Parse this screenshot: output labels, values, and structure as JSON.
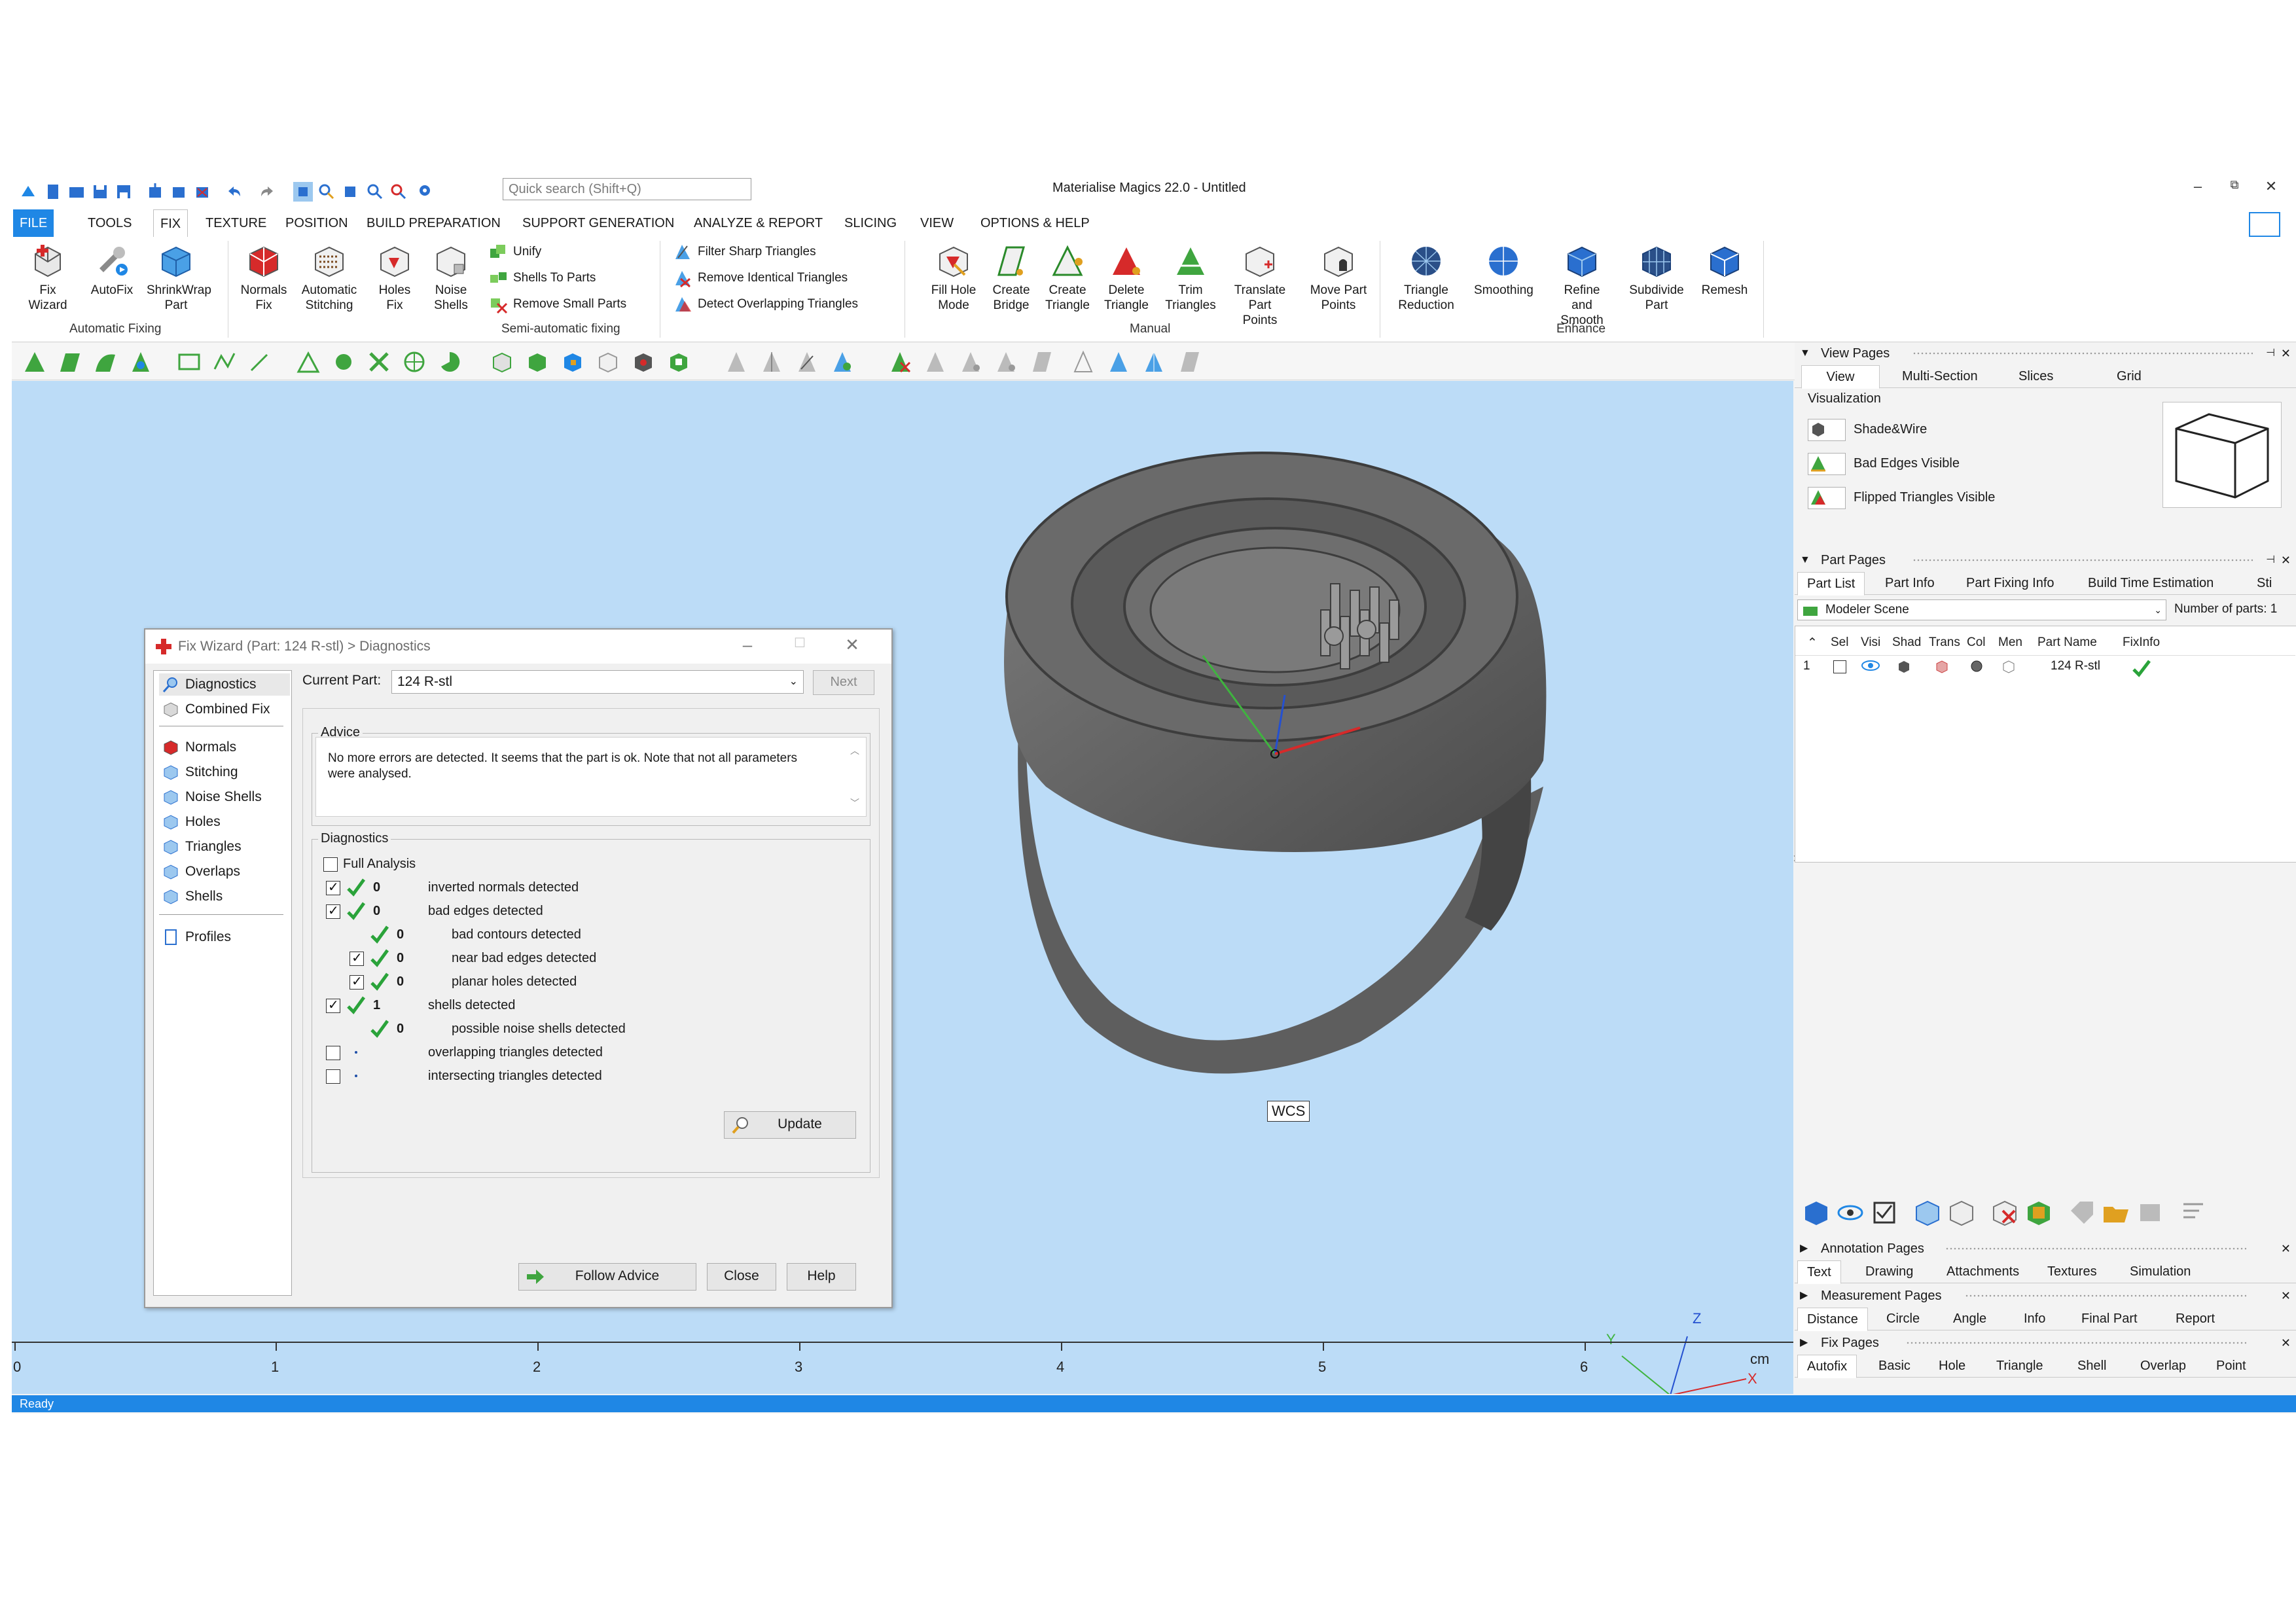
{
  "window": {
    "title": "Materialise Magics 22.0 - Untitled",
    "search_placeholder": "Quick search (Shift+Q)",
    "minimize": "–",
    "restore": "⧉",
    "close": "✕"
  },
  "menu": [
    "FILE",
    "TOOLS",
    "FIX",
    "TEXTURE",
    "POSITION",
    "BUILD PREPARATION",
    "SUPPORT GENERATION",
    "ANALYZE & REPORT",
    "SLICING",
    "VIEW",
    "OPTIONS & HELP"
  ],
  "ribbon": {
    "automatic_fixing": {
      "group": "Automatic Fixing",
      "buttons": [
        [
          "Fix",
          "Wizard"
        ],
        [
          "AutoFix",
          ""
        ],
        [
          "ShrinkWrap",
          "Part"
        ]
      ]
    },
    "semi_auto": {
      "group": "Semi-automatic fixing",
      "buttons": [
        [
          "Normals",
          "Fix"
        ],
        [
          "Automatic",
          "Stitching"
        ],
        [
          "Holes",
          "Fix"
        ],
        [
          "Noise",
          "Shells"
        ]
      ],
      "small": [
        "Unify",
        "Shells To Parts",
        "Remove Small Parts"
      ]
    },
    "triangles": {
      "small": [
        "Filter Sharp Triangles",
        "Remove Identical Triangles",
        "Detect Overlapping Triangles"
      ]
    },
    "manual": {
      "group": "Manual",
      "buttons": [
        [
          "Fill Hole",
          "Mode"
        ],
        [
          "Create",
          "Bridge"
        ],
        [
          "Create",
          "Triangle"
        ],
        [
          "Delete",
          "Triangle"
        ],
        [
          "Trim",
          "Triangles"
        ],
        [
          "Translate",
          "Part Points"
        ],
        [
          "Move Part",
          "Points"
        ]
      ]
    },
    "enhance": {
      "group": "Enhance",
      "buttons": [
        [
          "Triangle",
          "Reduction"
        ],
        [
          "Smoothing",
          ""
        ],
        [
          "Refine and",
          "Smooth"
        ],
        [
          "Subdivide",
          "Part"
        ],
        [
          "Remesh",
          ""
        ]
      ]
    }
  },
  "viewport": {
    "wcs_label": "WCS",
    "axis_x": "X",
    "axis_y": "Y",
    "axis_z": "Z",
    "ruler": [
      "0",
      "1",
      "2",
      "3",
      "4",
      "5",
      "6"
    ],
    "ruler_unit": "cm"
  },
  "status": "Ready",
  "dialog": {
    "title": "Fix Wizard (Part: 124 R-stl) > Diagnostics",
    "nav": [
      "Diagnostics",
      "Combined Fix",
      "Normals",
      "Stitching",
      "Noise Shells",
      "Holes",
      "Triangles",
      "Overlaps",
      "Shells",
      "Profiles"
    ],
    "current_part_label": "Current Part:",
    "current_part": "124 R-stl",
    "next": "Next",
    "advice_label": "Advice",
    "advice_text": "No more errors are detected. It seems that the part is ok. Note that not all parameters were analysed.",
    "diagnostics_label": "Diagnostics",
    "full_analysis": "Full Analysis",
    "rows": [
      {
        "count": "0",
        "text": "inverted normals detected"
      },
      {
        "count": "0",
        "text": "bad edges detected"
      },
      {
        "count": "0",
        "text": "bad contours detected"
      },
      {
        "count": "0",
        "text": "near bad edges detected"
      },
      {
        "count": "0",
        "text": "planar holes detected"
      },
      {
        "count": "1",
        "text": "shells detected"
      },
      {
        "count": "0",
        "text": "possible noise shells detected"
      },
      {
        "count": "",
        "text": "overlapping triangles detected"
      },
      {
        "count": "",
        "text": "intersecting triangles detected"
      }
    ],
    "update": "Update",
    "follow_advice": "Follow Advice",
    "close": "Close",
    "help": "Help"
  },
  "panels": {
    "view_pages": {
      "title": "View Pages",
      "tabs": [
        "View",
        "Multi-Section",
        "Slices",
        "Grid"
      ],
      "section": "Visualization",
      "rows": [
        "Shade&Wire",
        "Bad Edges Visible",
        "Flipped Triangles Visible"
      ]
    },
    "part_pages": {
      "title": "Part Pages",
      "tabs": [
        "Part List",
        "Part Info",
        "Part Fixing Info",
        "Build Time Estimation",
        "Sti"
      ],
      "scene": "Modeler Scene",
      "num_parts_label": "Number of parts: 1",
      "columns": [
        "Sel",
        "Visi",
        "Shad",
        "Trans",
        "Col",
        "Men",
        "Part Name",
        "FixInfo"
      ],
      "row": {
        "index": "1",
        "name": "124 R-stl"
      }
    },
    "annotation_pages": {
      "title": "Annotation Pages",
      "tabs": [
        "Text",
        "Drawing",
        "Attachments",
        "Textures",
        "Simulation"
      ]
    },
    "measurement_pages": {
      "title": "Measurement Pages",
      "tabs": [
        "Distance",
        "Circle",
        "Angle",
        "Info",
        "Final Part",
        "Report"
      ]
    },
    "fix_pages": {
      "title": "Fix Pages",
      "tabs": [
        "Autofix",
        "Basic",
        "Hole",
        "Triangle",
        "Shell",
        "Overlap",
        "Point"
      ]
    }
  },
  "colors": {
    "accent": "#1f87e5",
    "viewport_bg": "#bcdcf7",
    "ok_green": "#2aa33a",
    "axis_x": "#d62a2a",
    "axis_y": "#3fb43f",
    "axis_z": "#2450d0"
  }
}
